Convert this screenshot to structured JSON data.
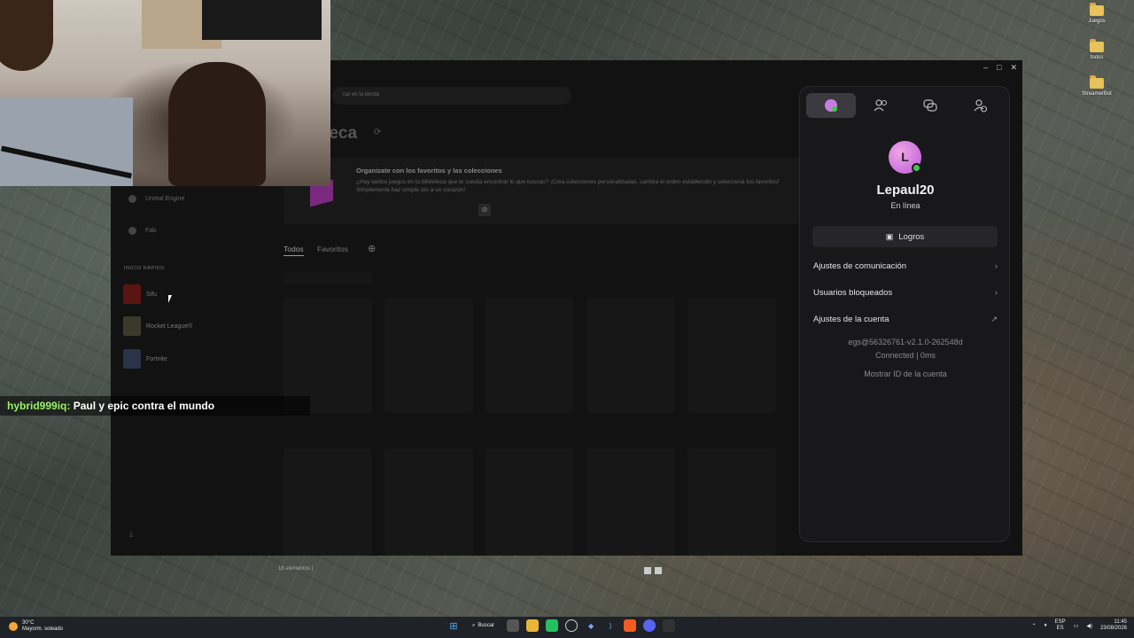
{
  "desktop": {
    "icons": [
      {
        "label": "Juegos"
      },
      {
        "label": "todos"
      },
      {
        "label": "StreamerBot"
      }
    ]
  },
  "epic": {
    "search_placeholder": "car en la tienda",
    "library_title": "teca",
    "banner": {
      "heading": "Organizate con los favoritos y las colecciones",
      "text": "¿Hay tantos juegos en tu biblioteca que te cuesta encontrar lo que buscas? ¡Crea colecciones personalizadas, cambia el orden establecido y selecciona tus favoritos! Simplemente haz simple clic a un corazón!"
    },
    "tabs": [
      "Todos",
      "Favoritos"
    ],
    "sidebar": {
      "items": [
        {
          "label": "Unreal Engine"
        },
        {
          "label": "Fab"
        }
      ],
      "quick_title": "INICIO RÁPIDO",
      "quick": [
        {
          "label": "Sifu"
        },
        {
          "label": "Rocket League®"
        },
        {
          "label": "Fortnite"
        }
      ]
    },
    "status_count": "18 elementos"
  },
  "chat": {
    "user": "hybrid999iq:",
    "message": "Paul y epic contra el mundo"
  },
  "profile": {
    "avatar_letter": "L",
    "username": "Lepaul20",
    "status": "En línea",
    "logros_label": "Logros",
    "rows": [
      {
        "label": "Ajustes de comunicación",
        "icon": "chevron-right-icon"
      },
      {
        "label": "Usuarios bloqueados",
        "icon": "chevron-right-icon"
      },
      {
        "label": "Ajustes de la cuenta",
        "icon": "external-link-icon"
      }
    ],
    "build": "egs@56326761-v2.1.0-262548d",
    "connection": "Connected | 0ms",
    "show_id": "Mostrar ID de la cuenta"
  },
  "taskbar": {
    "weather_temp": "30°C",
    "weather_desc": "Mayorm. soleado",
    "search_label": "Buscar",
    "lang_top": "ESP",
    "lang_bottom": "ES",
    "time": "11:45",
    "date": "23/08/2026"
  },
  "colors": {
    "online": "#42c64e",
    "chat_user": "#9bf26a",
    "avatar": "#c77ddf"
  }
}
